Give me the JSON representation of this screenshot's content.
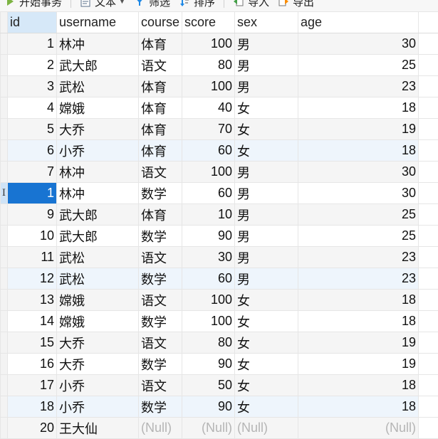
{
  "toolbar": {
    "items": [
      {
        "label": "开始事务",
        "icon": "begin-transaction-icon"
      },
      {
        "label": "文本",
        "icon": "text-view-icon"
      },
      {
        "label": "筛选",
        "icon": "filter-icon"
      },
      {
        "label": "排序",
        "icon": "sort-icon"
      },
      {
        "label": "导入",
        "icon": "import-icon"
      },
      {
        "label": "导出",
        "icon": "export-icon"
      }
    ]
  },
  "grid": {
    "columns": [
      "id",
      "username",
      "course",
      "score",
      "sex",
      "age"
    ],
    "null_label": "(Null)",
    "rows": [
      {
        "id": "1",
        "username": "林冲",
        "course": "体育",
        "score": "100",
        "sex": "男",
        "age": "30"
      },
      {
        "id": "2",
        "username": "武大郎",
        "course": "语文",
        "score": "80",
        "sex": "男",
        "age": "25"
      },
      {
        "id": "3",
        "username": "武松",
        "course": "体育",
        "score": "100",
        "sex": "男",
        "age": "23"
      },
      {
        "id": "4",
        "username": "嫦娥",
        "course": "体育",
        "score": "40",
        "sex": "女",
        "age": "18"
      },
      {
        "id": "5",
        "username": "大乔",
        "course": "体育",
        "score": "70",
        "sex": "女",
        "age": "19"
      },
      {
        "id": "6",
        "username": "小乔",
        "course": "体育",
        "score": "60",
        "sex": "女",
        "age": "18"
      },
      {
        "id": "7",
        "username": "林冲",
        "course": "语文",
        "score": "100",
        "sex": "男",
        "age": "30"
      },
      {
        "id": "1",
        "username": "林冲",
        "course": "数学",
        "score": "60",
        "sex": "男",
        "age": "30"
      },
      {
        "id": "9",
        "username": "武大郎",
        "course": "体育",
        "score": "10",
        "sex": "男",
        "age": "25"
      },
      {
        "id": "10",
        "username": "武大郎",
        "course": "数学",
        "score": "90",
        "sex": "男",
        "age": "25"
      },
      {
        "id": "11",
        "username": "武松",
        "course": "语文",
        "score": "30",
        "sex": "男",
        "age": "23"
      },
      {
        "id": "12",
        "username": "武松",
        "course": "数学",
        "score": "60",
        "sex": "男",
        "age": "23"
      },
      {
        "id": "13",
        "username": "嫦娥",
        "course": "语文",
        "score": "100",
        "sex": "女",
        "age": "18"
      },
      {
        "id": "14",
        "username": "嫦娥",
        "course": "数学",
        "score": "100",
        "sex": "女",
        "age": "18"
      },
      {
        "id": "15",
        "username": "大乔",
        "course": "语文",
        "score": "80",
        "sex": "女",
        "age": "19"
      },
      {
        "id": "16",
        "username": "大乔",
        "course": "数学",
        "score": "90",
        "sex": "女",
        "age": "19"
      },
      {
        "id": "17",
        "username": "小乔",
        "course": "语文",
        "score": "50",
        "sex": "女",
        "age": "18"
      },
      {
        "id": "18",
        "username": "小乔",
        "course": "数学",
        "score": "90",
        "sex": "女",
        "age": "18"
      },
      {
        "id": "20",
        "username": "王大仙",
        "course": null,
        "score": null,
        "sex": null,
        "age": null
      }
    ]
  },
  "state": {
    "current_row_index": 7,
    "selected_column": "id",
    "editing_marker": "I"
  },
  "colors": {
    "selection": "#1874d2",
    "header_selected": "#d6e8f8",
    "row_highlight": "#eef5fc",
    "row_alternate": "#f5f5f5",
    "null_text": "#b5b5b5"
  }
}
